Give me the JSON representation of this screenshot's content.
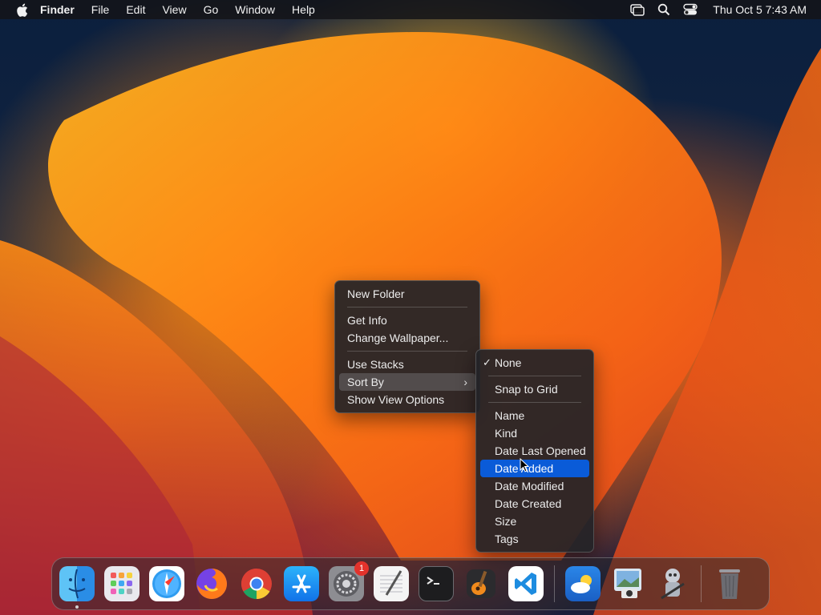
{
  "menubar": {
    "app_name": "Finder",
    "items": [
      "File",
      "Edit",
      "View",
      "Go",
      "Window",
      "Help"
    ],
    "right_icons": [
      "screen-mirroring-icon",
      "search-icon",
      "control-center-icon"
    ],
    "clock": "Thu Oct 5  7:43 AM"
  },
  "context_menu": {
    "items": {
      "new_folder": "New Folder",
      "get_info": "Get Info",
      "change_wallpaper": "Change Wallpaper...",
      "use_stacks": "Use Stacks",
      "sort_by": "Sort By",
      "show_view_options": "Show View Options"
    },
    "chevron": "›"
  },
  "sort_submenu": {
    "check_mark": "✓",
    "none": "None",
    "snap_to_grid": "Snap to Grid",
    "name": "Name",
    "kind": "Kind",
    "date_last_opened": "Date Last Opened",
    "date_added": "Date Added",
    "date_modified": "Date Modified",
    "date_created": "Date Created",
    "size": "Size",
    "tags": "Tags",
    "selected_item": "Date Added",
    "checked_item": "None"
  },
  "dock": {
    "apps": [
      "finder-icon",
      "launchpad-icon",
      "safari-icon",
      "firefox-icon",
      "chrome-icon",
      "app-store-icon",
      "system-settings-icon",
      "textedit-icon",
      "terminal-icon",
      "garageband-icon",
      "vscode-icon"
    ],
    "extras": [
      "weather-icon",
      "preview-icon",
      "automator-icon"
    ],
    "trash": "trash-icon",
    "settings_badge": "1"
  },
  "colors": {
    "selection": "#0a5bd8",
    "badge": "#e3322b"
  }
}
